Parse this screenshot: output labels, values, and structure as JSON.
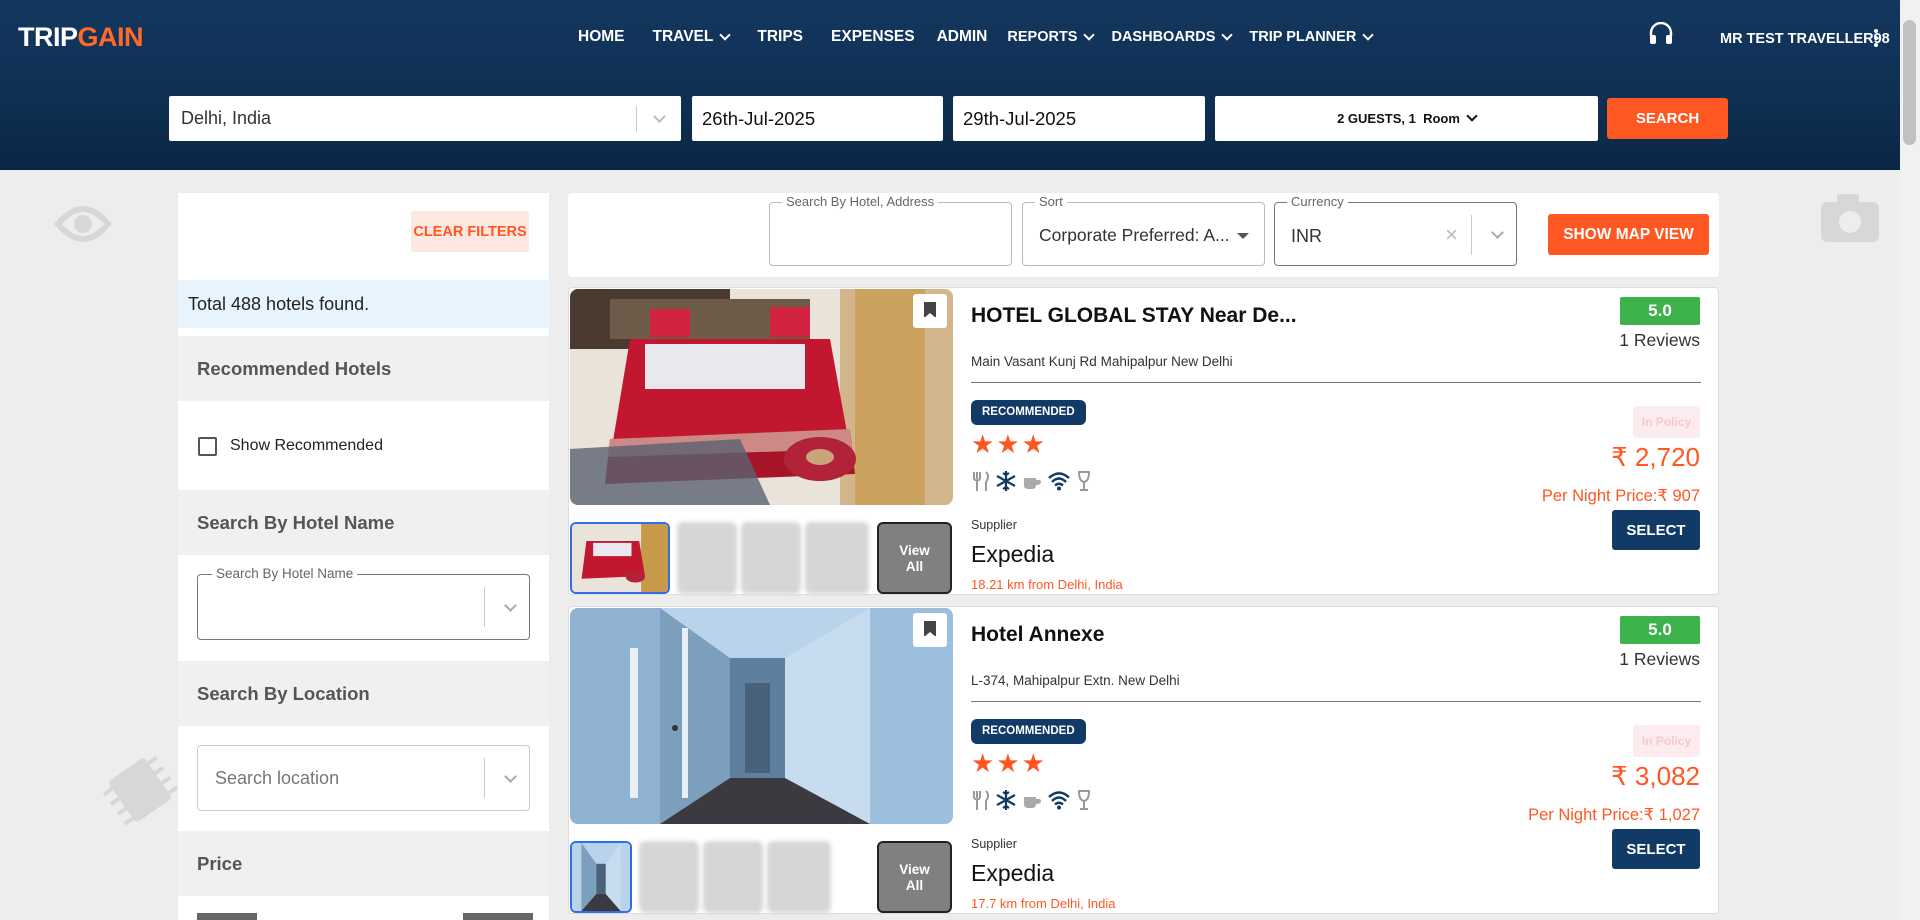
{
  "header": {
    "logo_trip": "TRIP",
    "logo_gain": "GAIN",
    "nav": [
      {
        "label": "HOME",
        "dropdown": false
      },
      {
        "label": "TRAVEL",
        "dropdown": true
      },
      {
        "label": "TRIPS",
        "dropdown": false
      },
      {
        "label": "EXPENSES",
        "dropdown": false
      },
      {
        "label": "ADMIN",
        "dropdown": false
      },
      {
        "label": "REPORTS",
        "dropdown": true
      },
      {
        "label": "DASHBOARDS",
        "dropdown": true
      },
      {
        "label": "TRIP PLANNER",
        "dropdown": true
      }
    ],
    "user_name": "MR TEST TRAVELLER98",
    "support_icon": "headset-icon",
    "menu_icon": "kebab-menu-icon"
  },
  "search": {
    "destination": "Delhi, India",
    "check_in": "26th-Jul-2025",
    "check_out": "29th-Jul-2025",
    "guests_text": "2 GUESTS, 1",
    "room_text": "Room",
    "search_label": "SEARCH"
  },
  "filters": {
    "clear_label": "CLEAR FILTERS",
    "total_text": "Total 488 hotels found.",
    "recommended_heading": "Recommended Hotels",
    "show_recommended_label": "Show Recommended",
    "show_recommended_checked": false,
    "hotel_name_heading": "Search By Hotel Name",
    "hotel_name_legend": "Search By Hotel Name",
    "location_heading": "Search By Location",
    "location_placeholder": "Search location",
    "price_heading": "Price"
  },
  "toolbar": {
    "address_legend": "Search By Hotel, Address",
    "sort_legend": "Sort",
    "sort_value": "Corporate Preferred: A...",
    "currency_legend": "Currency",
    "currency_value": "INR",
    "map_label": "SHOW MAP VIEW"
  },
  "hotels": [
    {
      "name": "HOTEL GLOBAL STAY Near De...",
      "address": "Main Vasant Kunj Rd Mahipalpur New Delhi",
      "badge": "RECOMMENDED",
      "stars": 3,
      "rating": "5.0",
      "reviews": "1 Reviews",
      "policy": "In Policy",
      "price": "₹ 2,720",
      "per_night": "Per Night Price:₹ 907",
      "select_label": "SELECT",
      "supplier_label": "Supplier",
      "supplier": "Expedia",
      "distance": "18.21 km from Delhi, India",
      "view_all": "View All"
    },
    {
      "name": "Hotel Annexe",
      "address": "L-374, Mahipalpur Extn. New Delhi",
      "badge": "RECOMMENDED",
      "stars": 3,
      "rating": "5.0",
      "reviews": "1 Reviews",
      "policy": "In Policy",
      "price": "₹ 3,082",
      "per_night": "Per Night Price:₹ 1,027",
      "select_label": "SELECT",
      "supplier_label": "Supplier",
      "supplier": "Expedia",
      "distance": "17.7 km from Delhi, India",
      "view_all": "View All"
    }
  ],
  "amenity_icons": [
    "restaurant-icon",
    "air-conditioning-icon",
    "coffee-icon",
    "wifi-icon",
    "bar-icon"
  ],
  "colors": {
    "header_bg": "#0f3054",
    "accent_orange": "#ff5722",
    "navy_button": "#123a66",
    "rating_green": "#3db14a"
  }
}
